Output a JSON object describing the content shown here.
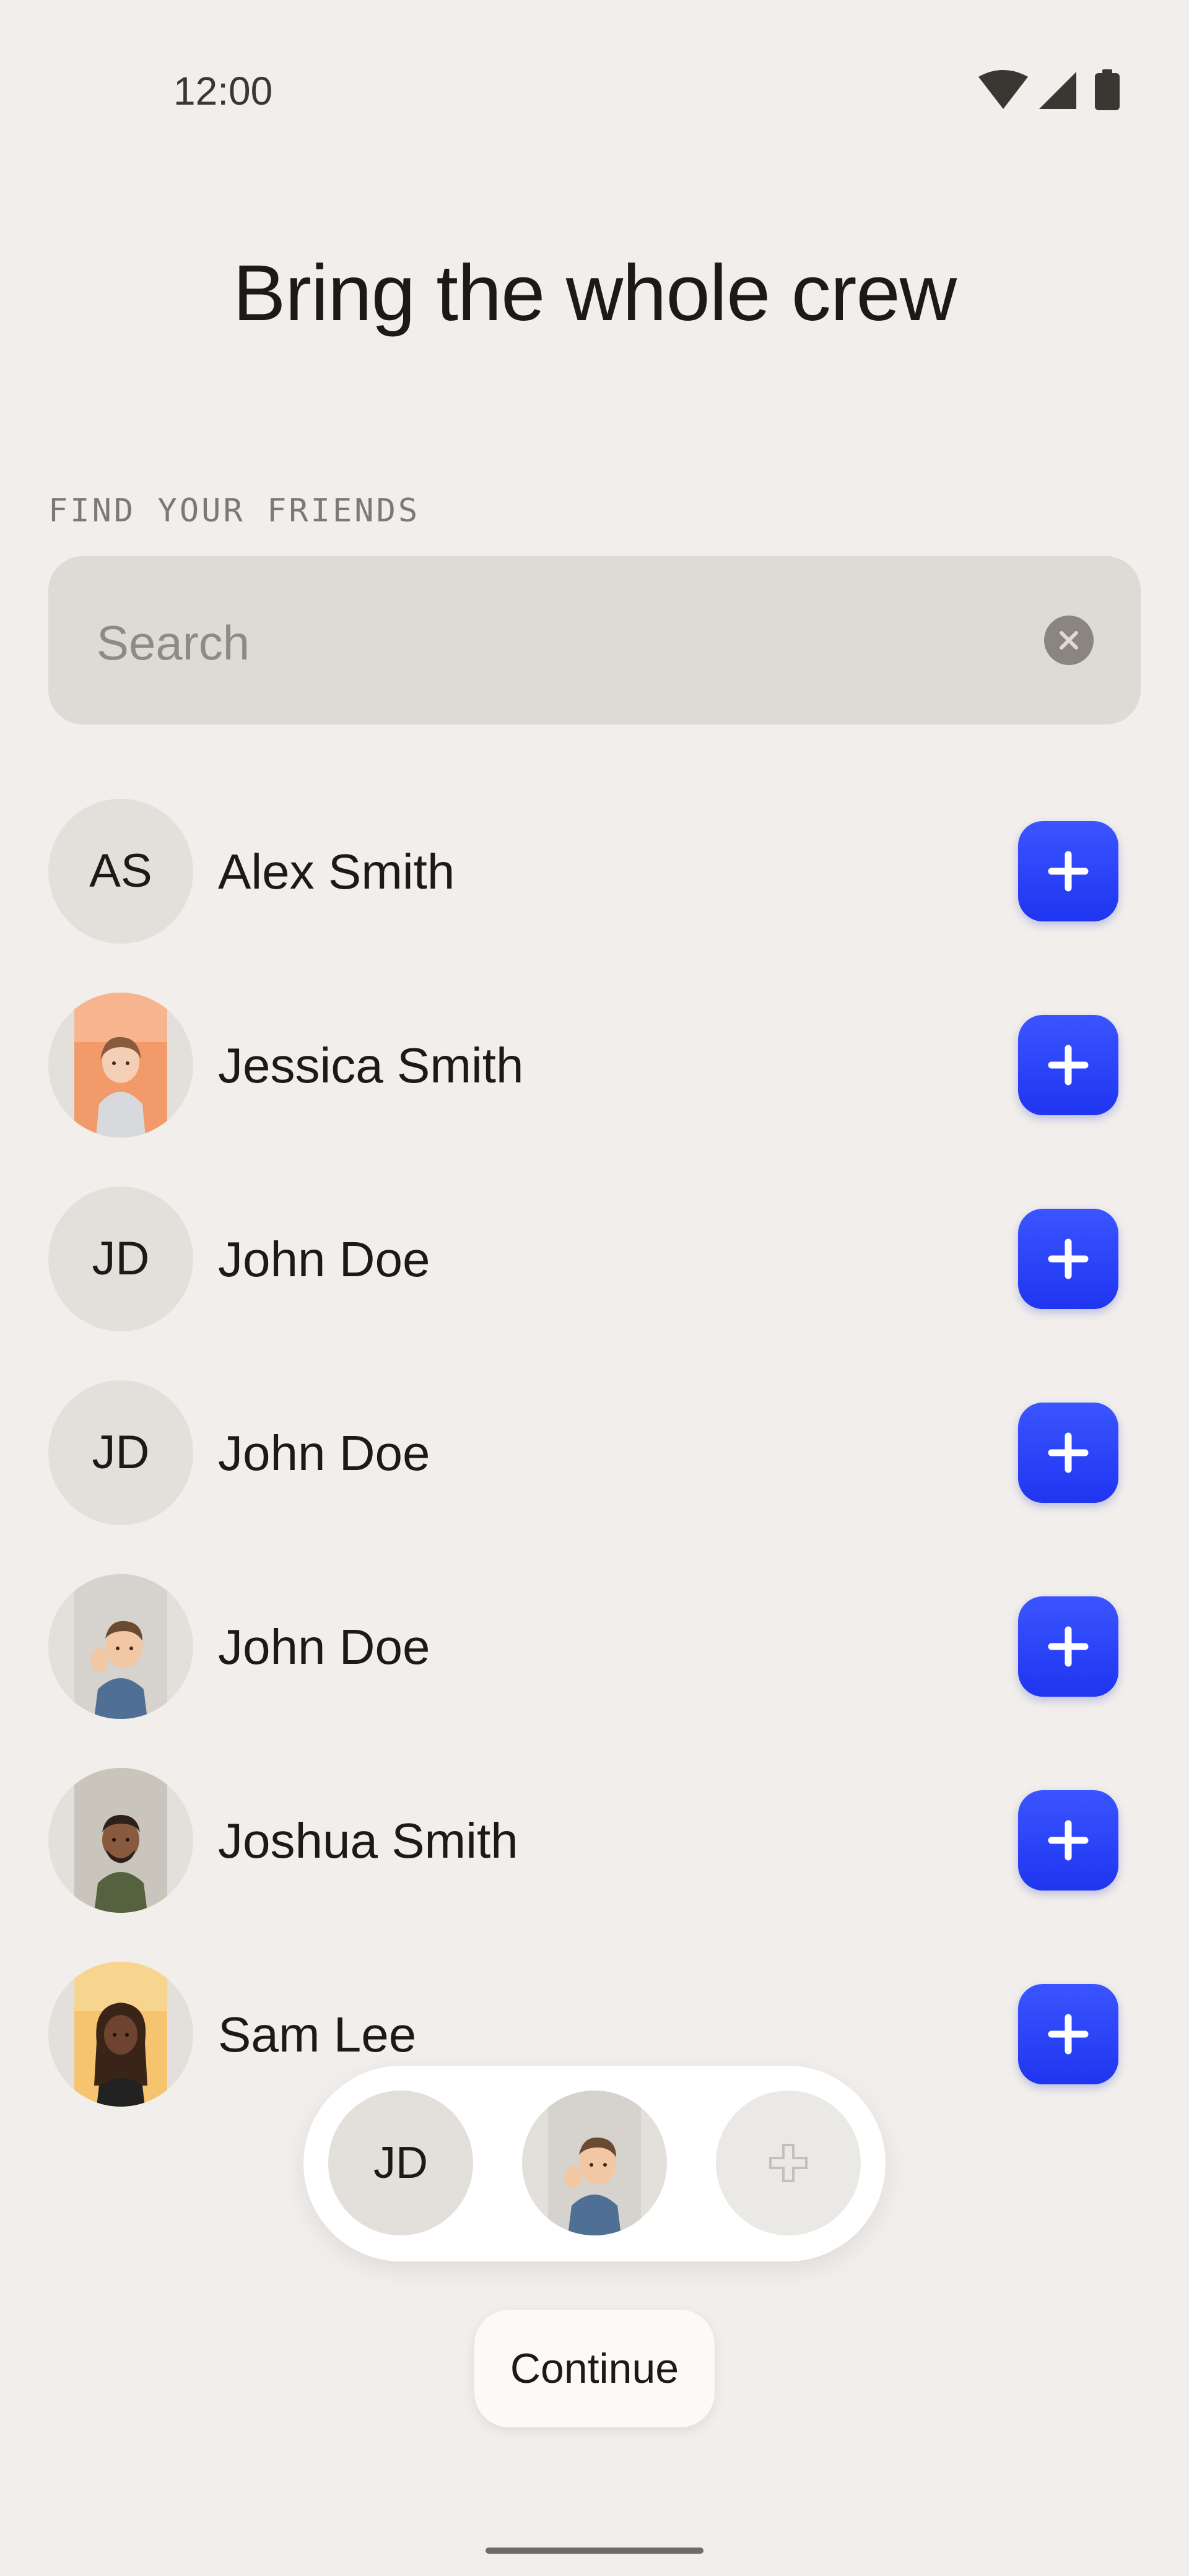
{
  "status_bar": {
    "time": "12:00"
  },
  "title": "Bring the whole crew",
  "section_label": "FIND YOUR FRIENDS",
  "search": {
    "placeholder": "Search",
    "value": ""
  },
  "contacts": [
    {
      "name": "Alex Smith",
      "initials": "AS",
      "avatar": "initials"
    },
    {
      "name": "Jessica Smith",
      "avatar": "memoji-woman-orange-bg"
    },
    {
      "name": "John Doe",
      "initials": "JD",
      "avatar": "initials"
    },
    {
      "name": "John Doe",
      "initials": "JD",
      "avatar": "initials"
    },
    {
      "name": "John Doe",
      "avatar": "memoji-man-thumbs-up"
    },
    {
      "name": "Joshua Smith",
      "avatar": "memoji-man-dark-green-shirt"
    },
    {
      "name": "Sam Lee",
      "avatar": "memoji-woman-yellow-bg"
    }
  ],
  "selected_tray": [
    {
      "initials": "JD",
      "avatar": "initials"
    },
    {
      "avatar": "memoji-man-thumbs-up"
    },
    {
      "avatar": "plus-placeholder"
    }
  ],
  "continue_label": "Continue",
  "colors": {
    "background": "#f1eeeb",
    "accent": "#2a42f8",
    "search_bg": "#dedbd7"
  }
}
